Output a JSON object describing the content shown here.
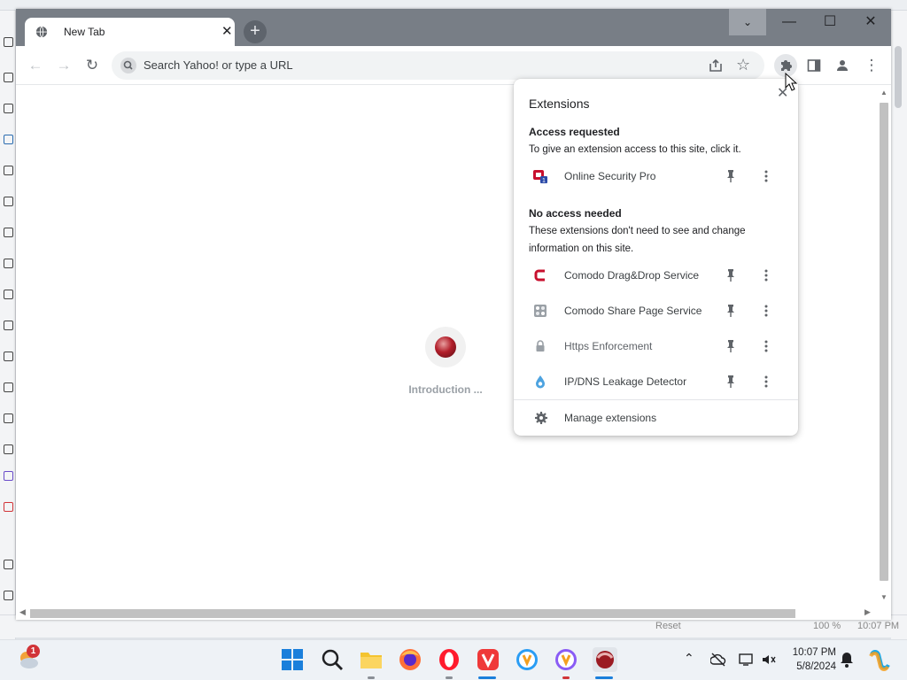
{
  "browser": {
    "tab": {
      "title": "New Tab",
      "close": "✕"
    },
    "new_tab": "+",
    "window_controls": {
      "dropdown": "⌄",
      "minimize": "—",
      "maximize": "☐",
      "close": "✕"
    },
    "omnibox": {
      "placeholder": "Search Yahoo! or type a URL"
    },
    "toolbar": {
      "back": "←",
      "forward": "→",
      "reload": "↻",
      "star": "☆",
      "menu": "⋮"
    }
  },
  "page": {
    "loading_text": "Introduction ..."
  },
  "extensions_popup": {
    "title": "Extensions",
    "close": "✕",
    "access_requested": {
      "heading": "Access requested",
      "description": "To give an extension access to this site, click it.",
      "items": [
        {
          "name": "Online Security Pro",
          "icon": "online-security-pro-icon"
        }
      ]
    },
    "no_access_needed": {
      "heading": "No access needed",
      "description": "These extensions don't need to see and change information on this site.",
      "items": [
        {
          "name": "Comodo Drag&Drop Service",
          "icon": "comodo-c-icon"
        },
        {
          "name": "Comodo Share Page Service",
          "icon": "share-page-icon"
        },
        {
          "name": "Https Enforcement",
          "icon": "lock-icon"
        },
        {
          "name": "IP/DNS Leakage Detector",
          "icon": "leak-detector-icon"
        }
      ]
    },
    "manage": "Manage extensions"
  },
  "background_app": {
    "status": {
      "reset": "Reset",
      "zoom": "100 %",
      "time": "10:07 PM"
    }
  },
  "taskbar": {
    "weather_badge": "1",
    "time": "10:07 PM",
    "date": "5/8/2024"
  },
  "colors": {
    "tabstrip": "#787e86",
    "accent_red": "#c8102e",
    "popup_bg": "#ffffff"
  }
}
